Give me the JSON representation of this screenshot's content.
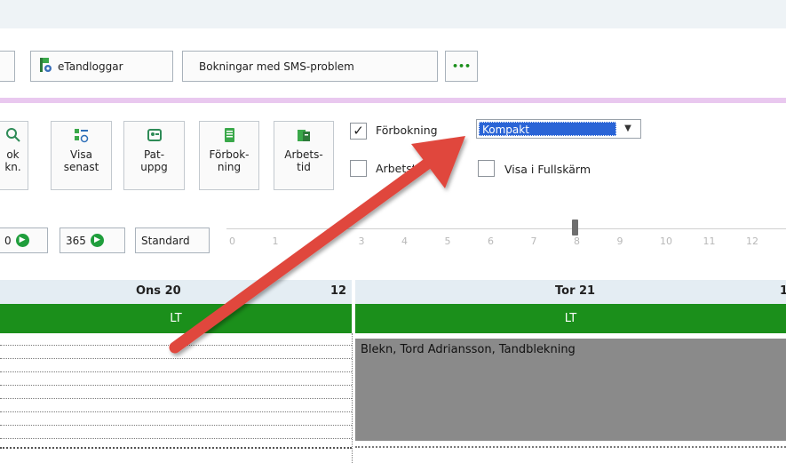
{
  "toolbar": {
    "etandloggar_label": "eTandloggar",
    "sms_problem_label": "Bokningar med SMS-problem",
    "more_label": "•••"
  },
  "ribbon": {
    "buttons": [
      {
        "label_line1": "ok",
        "label_line2": "kn.",
        "icon": "search-icon"
      },
      {
        "label_line1": "Visa",
        "label_line2": "senast",
        "icon": "list-recent-icon"
      },
      {
        "label_line1": "Pat-",
        "label_line2": "uppg",
        "icon": "patient-card-icon"
      },
      {
        "label_line1": "Förbok-",
        "label_line2": "ning",
        "icon": "document-icon"
      },
      {
        "label_line1": "Arbets-",
        "label_line2": "tid",
        "icon": "worktime-icon"
      }
    ],
    "forbokning_label": "Förbokning",
    "forbokning_checked": true,
    "arbetstid_label": "Arbetstid",
    "arbetstid_checked": false,
    "view_mode_value": "Kompakt",
    "fullscreen_label": "Visa i Fullskärm",
    "fullscreen_checked": false
  },
  "nav": {
    "btn_a_label": "0",
    "btn_b_label": "365",
    "standard_label": "Standard",
    "slider_ticks": [
      "0",
      "1",
      "2",
      "3",
      "4",
      "5",
      "6",
      "7",
      "8",
      "9",
      "10",
      "11",
      "12"
    ],
    "slider_value": 8
  },
  "calendar": {
    "day1_label": "Ons 20",
    "day1_num": "12",
    "day1_code": "LT",
    "day2_label": "Tor 21",
    "day2_num": "1",
    "day2_code": "LT",
    "booking_text": "Blekn, Tord Adriansson, Tandblekning"
  },
  "colors": {
    "accent_green": "#1b8f1b",
    "selection_blue": "#2a64d6",
    "arrow_red": "#e0463e"
  }
}
